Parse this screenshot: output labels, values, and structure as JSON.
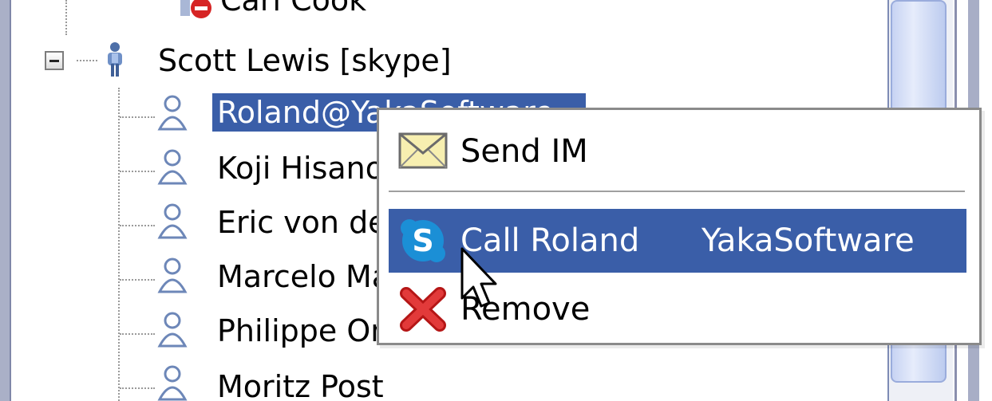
{
  "tree": {
    "partial_top_label": "Carl Cook",
    "group": {
      "label": "Scott Lewis [skype]",
      "expanded": true
    },
    "contacts": [
      {
        "label": "Roland@YakaSoftware",
        "selected": true
      },
      {
        "label": "Koji Hisano",
        "selected": false
      },
      {
        "label": "Eric von der Kellen",
        "selected": false
      },
      {
        "label": "Marcelo Mayworm",
        "selected": false
      },
      {
        "label": "Philippe Ombredanne",
        "selected": false
      },
      {
        "label": "Moritz Post",
        "selected": false
      }
    ]
  },
  "context_menu": {
    "items": [
      {
        "label": "Send IM",
        "shortcut": "",
        "icon": "envelope-icon",
        "highlighted": false
      },
      {
        "label": "Call Roland",
        "shortcut": "YakaSoftware",
        "icon": "skype-icon",
        "highlighted": true
      },
      {
        "label": "Remove",
        "shortcut": "",
        "icon": "red-x-icon",
        "highlighted": false
      }
    ]
  },
  "colors": {
    "selection": "#3a5ea8",
    "selection_text": "#ffffff",
    "skype_blue": "#1b8fd6",
    "remove_red": "#d62424"
  }
}
